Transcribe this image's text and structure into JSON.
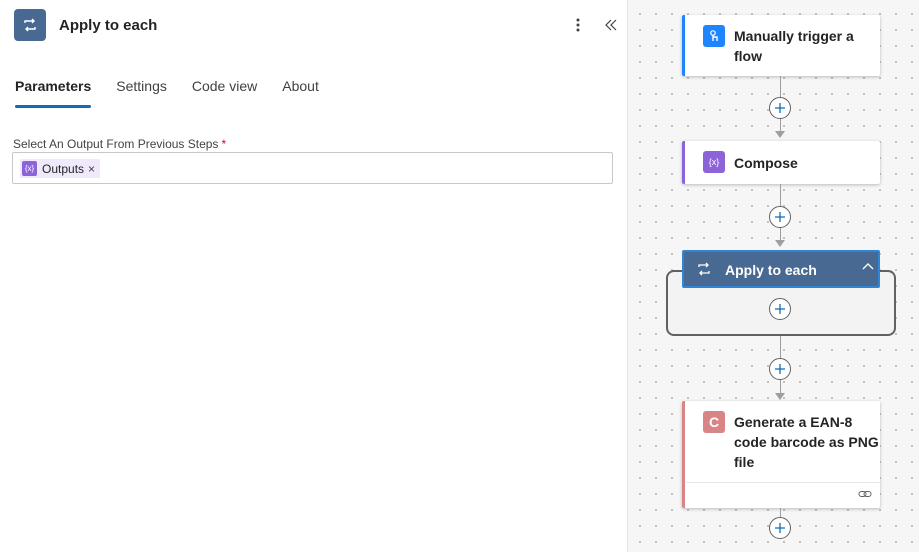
{
  "panel": {
    "title": "Apply to each",
    "icon": "loop-icon",
    "more_icon": "more-vertical-icon",
    "collapse_icon": "double-chevron-left-icon",
    "tabs": [
      {
        "label": "Parameters",
        "active": true
      },
      {
        "label": "Settings",
        "active": false
      },
      {
        "label": "Code view",
        "active": false
      },
      {
        "label": "About",
        "active": false
      }
    ],
    "field": {
      "label": "Select An Output From Previous Steps",
      "required_mark": "*",
      "token": {
        "label": "Outputs",
        "icon": "{x}",
        "remove": "×"
      }
    }
  },
  "canvas": {
    "nodes": [
      {
        "title": "Manually trigger a flow",
        "lines": [
          "Manually trigger a",
          "flow"
        ],
        "icon": "touch-trigger-icon",
        "color": "#1f85ff"
      },
      {
        "title": "Compose",
        "icon": "{x}",
        "color": "#8d63da"
      },
      {
        "title": "Apply to each",
        "icon": "loop-icon",
        "color": "#486991",
        "expanded": true
      },
      {
        "title": "Generate a EAN-8 code barcode as PNG file",
        "lines": [
          "Generate a EAN-8",
          "code barcode as PNG",
          "file"
        ],
        "icon": "C",
        "color": "#d98585"
      }
    ],
    "add_icon": "plus-icon",
    "link_icon": "link-icon"
  },
  "colors": {
    "accent": "#0f6cbd",
    "loop": "#486991",
    "compose": "#8d63da",
    "trigger": "#1f85ff",
    "connector": "#d98585"
  }
}
